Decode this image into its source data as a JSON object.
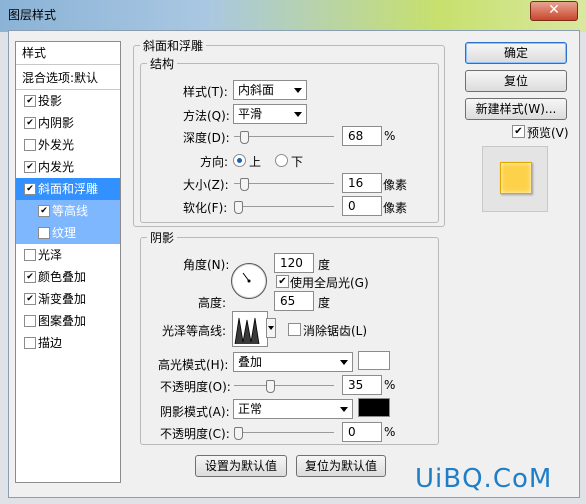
{
  "window": {
    "title": "图层样式",
    "close_glyph": "✕"
  },
  "styles_list": {
    "header": "样式",
    "blend": "混合选项:默认",
    "items": [
      {
        "label": "投影",
        "checked": true
      },
      {
        "label": "内阴影",
        "checked": true
      },
      {
        "label": "外发光",
        "checked": false
      },
      {
        "label": "内发光",
        "checked": true
      },
      {
        "label": "斜面和浮雕",
        "checked": true,
        "selected": true
      },
      {
        "label": "等高线",
        "checked": true,
        "sub": true
      },
      {
        "label": "纹理",
        "checked": false,
        "sub": true
      },
      {
        "label": "光泽",
        "checked": false
      },
      {
        "label": "颜色叠加",
        "checked": true
      },
      {
        "label": "渐变叠加",
        "checked": true
      },
      {
        "label": "图案叠加",
        "checked": false
      },
      {
        "label": "描边",
        "checked": false
      }
    ]
  },
  "bevel": {
    "title": "斜面和浮雕",
    "structure_title": "结构",
    "style_label": "样式(T):",
    "style_value": "内斜面",
    "technique_label": "方法(Q):",
    "technique_value": "平滑",
    "depth_label": "深度(D):",
    "depth_value": "68",
    "depth_unit": "%",
    "depth_fraction": 0.068,
    "direction_label": "方向:",
    "dir_up": "上",
    "dir_down": "下",
    "direction_selected": "上",
    "size_label": "大小(Z):",
    "size_value": "16",
    "size_unit": "像素",
    "size_fraction": 0.064,
    "soften_label": "软化(F):",
    "soften_value": "0",
    "soften_unit": "像素",
    "soften_fraction": 0.0
  },
  "shading": {
    "title": "阴影",
    "angle_label": "角度(N):",
    "angle_value": "120",
    "angle_unit": "度",
    "global_light_label": "使用全局光(G)",
    "global_light_checked": true,
    "altitude_label": "高度:",
    "altitude_value": "65",
    "altitude_unit": "度",
    "gloss_label": "光泽等高线:",
    "antialias_label": "消除锯齿(L)",
    "antialias_checked": false,
    "highlight_mode_label": "高光模式(H):",
    "highlight_mode_value": "叠加",
    "highlight_color": "#ffffff",
    "highlight_opacity_label": "不透明度(O):",
    "highlight_opacity_value": "35",
    "highlight_opacity_unit": "%",
    "highlight_opacity_fraction": 0.35,
    "shadow_mode_label": "阴影模式(A):",
    "shadow_mode_value": "正常",
    "shadow_color": "#000000",
    "shadow_opacity_label": "不透明度(C):",
    "shadow_opacity_value": "0",
    "shadow_opacity_unit": "%",
    "shadow_opacity_fraction": 0.0
  },
  "footer": {
    "make_default": "设置为默认值",
    "reset_default": "复位为默认值"
  },
  "actions": {
    "ok": "确定",
    "reset": "复位",
    "new_style": "新建样式(W)...",
    "preview_label": "预览(V)",
    "preview_checked": true,
    "preview_color": "#fdd24a"
  },
  "watermark": {
    "brand": "UiBQ.CoM"
  }
}
